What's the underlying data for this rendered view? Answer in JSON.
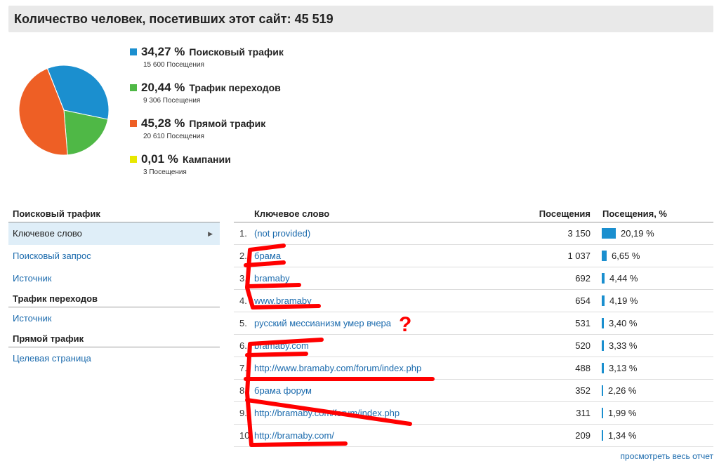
{
  "header": {
    "title": "Количество человек, посетивших этот сайт: 45 519"
  },
  "chart_data": {
    "type": "pie",
    "title": "",
    "slices": [
      {
        "label": "Поисковый трафик",
        "percent": 34.27,
        "visits": 15600,
        "color": "#1b8fcf"
      },
      {
        "label": "Трафик переходов",
        "percent": 20.44,
        "visits": 9306,
        "color": "#4fb846"
      },
      {
        "label": "Прямой трафик",
        "percent": 45.28,
        "visits": 20610,
        "color": "#ee5f25"
      },
      {
        "label": "Кампании",
        "percent": 0.01,
        "visits": 3,
        "color": "#eeee00"
      }
    ]
  },
  "legend": [
    {
      "pct": "34,27 %",
      "name": "Поисковый трафик",
      "sub": "15 600 Посещения",
      "color": "#1b8fcf"
    },
    {
      "pct": "20,44 %",
      "name": "Трафик переходов",
      "sub": "9 306 Посещения",
      "color": "#4fb846"
    },
    {
      "pct": "45,28 %",
      "name": "Прямой трафик",
      "sub": "20 610 Посещения",
      "color": "#ee5f25"
    },
    {
      "pct": "0,01 %",
      "name": "Кампании",
      "sub": "3 Посещения",
      "color": "#e8e800"
    }
  ],
  "sidebar": {
    "sections": [
      {
        "title": "Поисковый трафик",
        "items": [
          "Ключевое слово",
          "Поисковый запрос",
          "Источник"
        ]
      },
      {
        "title": "Трафик переходов",
        "items": [
          "Источник"
        ]
      },
      {
        "title": "Прямой трафик",
        "items": [
          "Целевая страница"
        ]
      }
    ]
  },
  "table": {
    "headers": {
      "keyword": "Ключевое слово",
      "visits": "Посещения",
      "percent": "Посещения, %"
    },
    "rows": [
      {
        "num": "1.",
        "keyword": "(not provided)",
        "visits": "3 150",
        "pct": "20,19 %",
        "share": 20.19
      },
      {
        "num": "2.",
        "keyword": "брама",
        "visits": "1 037",
        "pct": "6,65 %",
        "share": 6.65
      },
      {
        "num": "3.",
        "keyword": "bramaby",
        "visits": "692",
        "pct": "4,44 %",
        "share": 4.44
      },
      {
        "num": "4.",
        "keyword": "www.bramaby",
        "visits": "654",
        "pct": "4,19 %",
        "share": 4.19
      },
      {
        "num": "5.",
        "keyword": "русский мессианизм умер вчера",
        "visits": "531",
        "pct": "3,40 %",
        "share": 3.4
      },
      {
        "num": "6.",
        "keyword": "bramaby.com",
        "visits": "520",
        "pct": "3,33 %",
        "share": 3.33
      },
      {
        "num": "7.",
        "keyword": "http://www.bramaby.com/forum/index.php",
        "visits": "488",
        "pct": "3,13 %",
        "share": 3.13
      },
      {
        "num": "8.",
        "keyword": "брама форум",
        "visits": "352",
        "pct": "2,26 %",
        "share": 2.26
      },
      {
        "num": "9.",
        "keyword": "http://bramaby.com/forum/index.php",
        "visits": "311",
        "pct": "1,99 %",
        "share": 1.99
      },
      {
        "num": "10.",
        "keyword": "http://bramaby.com/",
        "visits": "209",
        "pct": "1,34 %",
        "share": 1.34
      }
    ]
  },
  "footer": {
    "link": "просмотреть весь отчет"
  },
  "annotations": {
    "question_mark": "?",
    "color": "#ff0000"
  }
}
